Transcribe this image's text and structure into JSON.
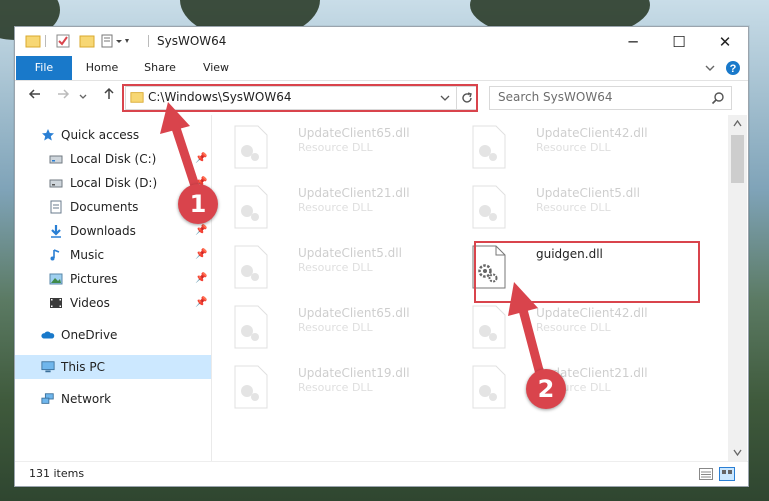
{
  "window": {
    "title": "SysWOW64",
    "minimize_glyph": "─",
    "maximize_glyph": "☐",
    "close_glyph": "✕"
  },
  "ribbon": {
    "tabs": [
      "File",
      "Home",
      "Share",
      "View"
    ]
  },
  "address": {
    "path": "C:\\Windows\\SysWOW64",
    "search_placeholder": "Search SysWOW64"
  },
  "sidebar": {
    "items": [
      {
        "label": "Quick access",
        "icon": "star-icon"
      },
      {
        "label": "Local Disk (C:)",
        "icon": "drive-icon",
        "pinned": true
      },
      {
        "label": "Local Disk (D:)",
        "icon": "drive-icon",
        "pinned": true
      },
      {
        "label": "Documents",
        "icon": "documents-icon",
        "pinned": true
      },
      {
        "label": "Downloads",
        "icon": "downloads-icon",
        "pinned": true
      },
      {
        "label": "Music",
        "icon": "music-icon",
        "pinned": true
      },
      {
        "label": "Pictures",
        "icon": "pictures-icon",
        "pinned": true
      },
      {
        "label": "Videos",
        "icon": "videos-icon",
        "pinned": true
      },
      {
        "label": "OneDrive",
        "icon": "onedrive-icon"
      },
      {
        "label": "This PC",
        "icon": "pc-icon",
        "selected": true
      },
      {
        "label": "Network",
        "icon": "network-icon"
      }
    ]
  },
  "files": [
    {
      "name": "UpdateClient65.dll",
      "type": "Resource DLL",
      "faded": true
    },
    {
      "name": "UpdateClient42.dll",
      "type": "Resource DLL",
      "faded": true
    },
    {
      "name": "UpdateClient21.dll",
      "type": "Resource DLL",
      "faded": true
    },
    {
      "name": "UpdateClient5.dll",
      "type": "Resource DLL",
      "faded": true
    },
    {
      "name": "UpdateClient5.dll",
      "type": "Resource DLL",
      "faded": true
    },
    {
      "name": "guidgen.dll",
      "type": "",
      "faded": false
    },
    {
      "name": "UpdateClient65.dll",
      "type": "Resource DLL",
      "faded": true
    },
    {
      "name": "UpdateClient42.dll",
      "type": "Resource DLL",
      "faded": true
    },
    {
      "name": "UpdateClient19.dll",
      "type": "Resource DLL",
      "faded": true
    },
    {
      "name": "UpdateClient21.dll",
      "type": "Resource DLL",
      "faded": true
    }
  ],
  "status": {
    "item_count": "131 items"
  },
  "annotations": {
    "step1": "1",
    "step2": "2",
    "color": "#d9444c"
  },
  "colors": {
    "file_tab": "#1979ca",
    "selection": "#cce8ff"
  }
}
